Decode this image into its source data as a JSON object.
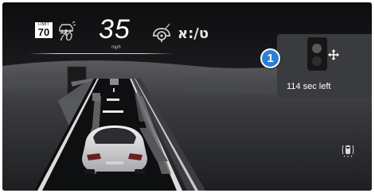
{
  "hud": {
    "speed_limit": {
      "header": "LIMIT",
      "value": "70"
    },
    "set_speed": "70",
    "current_speed": "35",
    "speed_unit": "mph",
    "mode_glyph": "ט/:א"
  },
  "callout": {
    "number": "1"
  },
  "status_panel": {
    "time_left": "114 sec left"
  },
  "icons": [
    "distance-assist-icon",
    "steering-wheel-icon",
    "traffic-light-icon",
    "move-arrows-icon",
    "parking-sensor-car-icon"
  ],
  "colors": {
    "callout_blue": "#2d7ed6",
    "panel_gray": "#3a3b3e",
    "background": "#1b1c1e"
  }
}
